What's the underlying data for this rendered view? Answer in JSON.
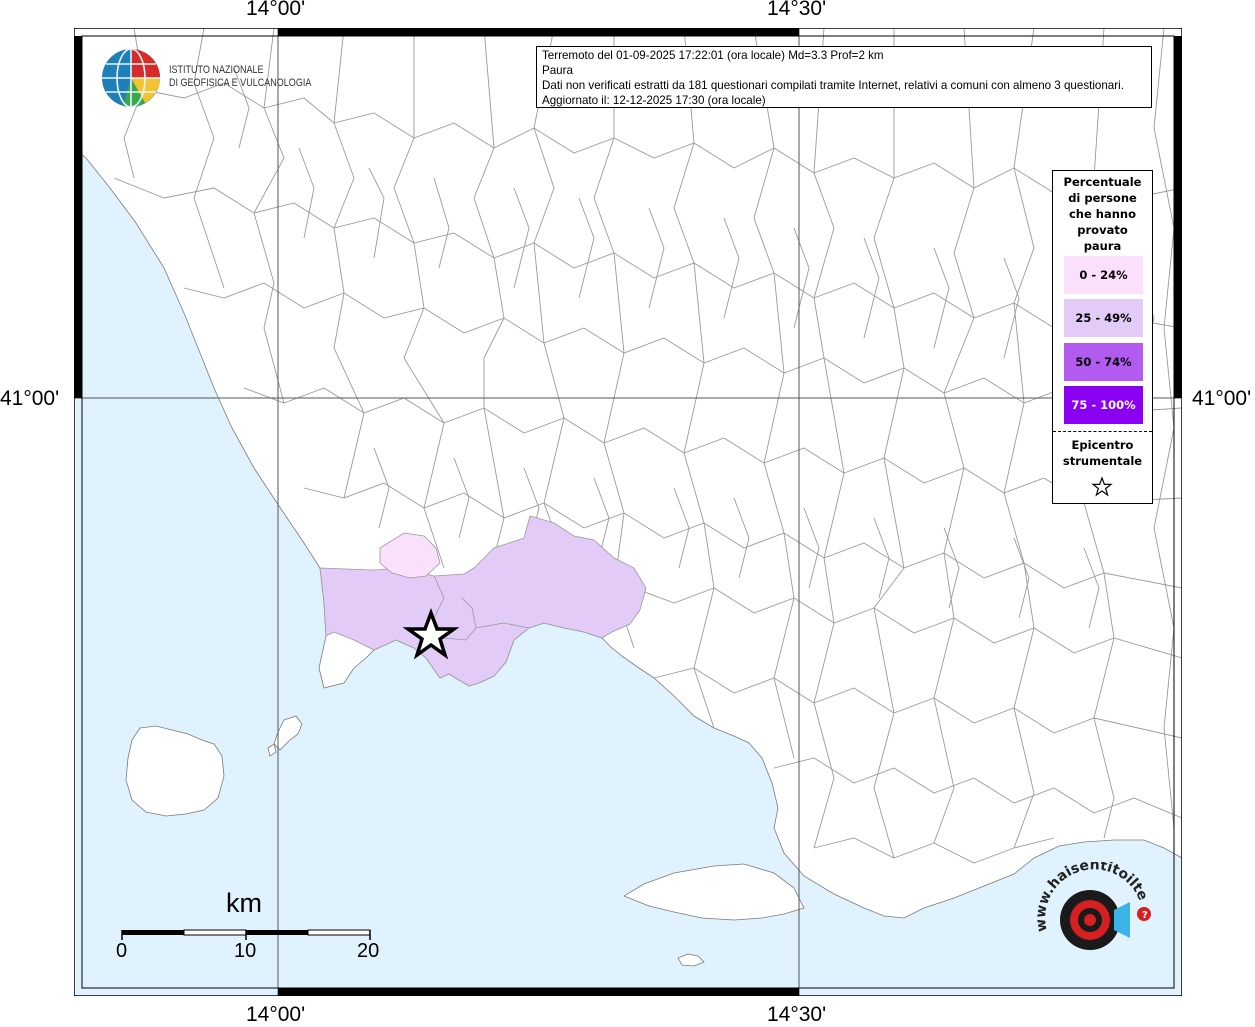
{
  "axes": {
    "top": [
      "14°00'",
      "14°30'"
    ],
    "bottom": [
      "14°00'",
      "14°30'"
    ],
    "left": [
      "41°00'"
    ],
    "right": [
      "41°00'"
    ]
  },
  "institute": {
    "line1": "ISTITUTO NAZIONALE",
    "line2": "DI GEOFISICA E VULCANOLOGIA"
  },
  "info": {
    "line1": "Terremoto del 01-09-2025 17:22:01 (ora locale) Md=3.3 Prof=2 km",
    "line2": "Paura",
    "line3": "Dati non verificati estratti da 181 questionari compilati tramite Internet, relativi a comuni con almeno 3 questionari.",
    "line4": "Aggiornato il: 12-12-2025 17:30 (ora locale)"
  },
  "legend": {
    "title": [
      "Percentuale",
      "di persone",
      "che hanno",
      "provato",
      "paura"
    ],
    "classes": [
      {
        "label": "0 - 24%",
        "color": "#fbe0fb"
      },
      {
        "label": "25 - 49%",
        "color": "#e2cbf6"
      },
      {
        "label": "50 - 74%",
        "color": "#b35af1"
      },
      {
        "label": "75 - 100%",
        "color": "#8a00f0"
      }
    ],
    "epicenter_title": [
      "Epicentro",
      "strumentale"
    ],
    "epicenter_icon": "star-outline-icon"
  },
  "scale_bar": {
    "unit": "km",
    "ticks": [
      "0",
      "10",
      "20"
    ]
  },
  "colors": {
    "sea": "#e0f2fd",
    "land": "#ffffff",
    "boundary": "#9a9a9a",
    "grid": "#555555"
  },
  "logo": {
    "text": "www.haisentitoilterremoto.it"
  }
}
